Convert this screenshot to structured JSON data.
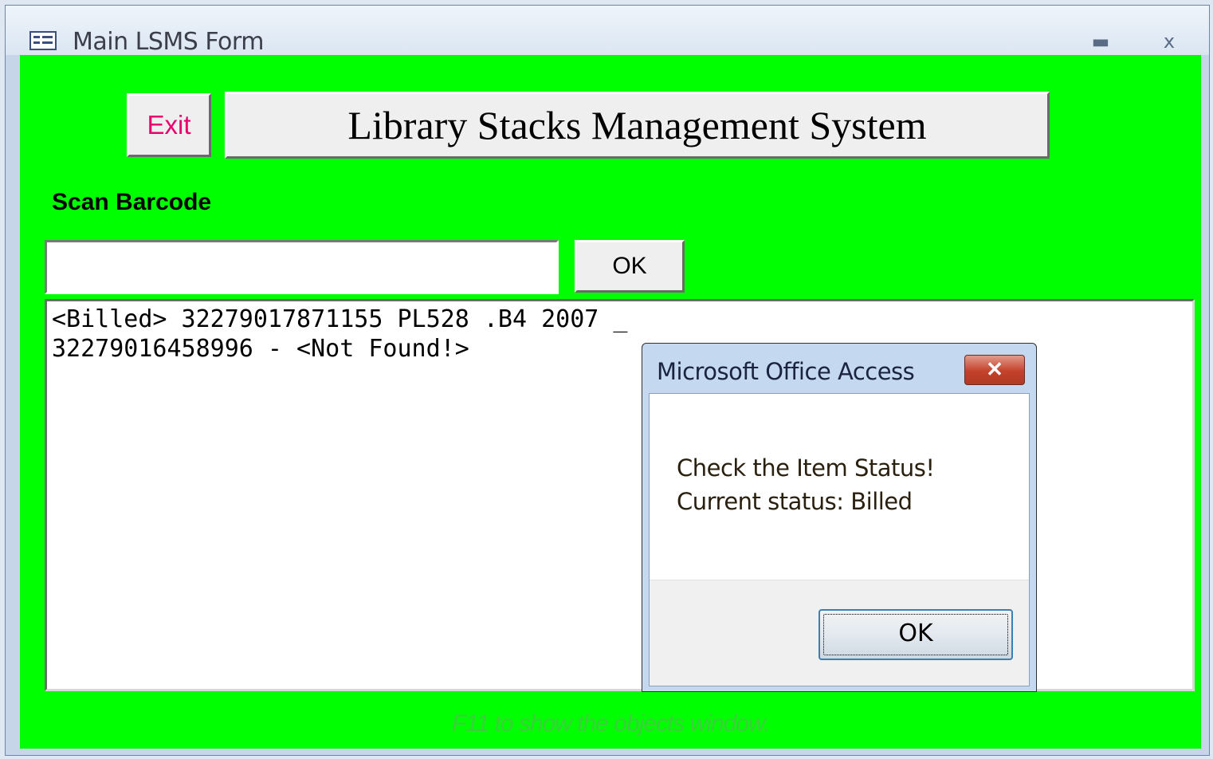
{
  "window": {
    "title": "Main LSMS Form",
    "minimize_glyph": "▬",
    "close_glyph": "x",
    "icon": "form-icon"
  },
  "form": {
    "background_color": "#00ff00",
    "exit_label": "Exit",
    "exit_color": "#e8006e",
    "system_title": "Library Stacks Management System",
    "scan_label": "Scan Barcode",
    "barcode_value": "",
    "ok_label": "OK",
    "log_lines": [
      "<Billed> 32279017871155 PL528 .B4 2007 _",
      "32279016458996 - <Not Found!>"
    ],
    "footer_hint": "F11 to show the objects window."
  },
  "dialog": {
    "title": "Microsoft Office Access",
    "close_glyph": "✕",
    "message_line1": "Check the Item Status!",
    "message_line2": "Current status: Billed",
    "ok_label": "OK"
  }
}
